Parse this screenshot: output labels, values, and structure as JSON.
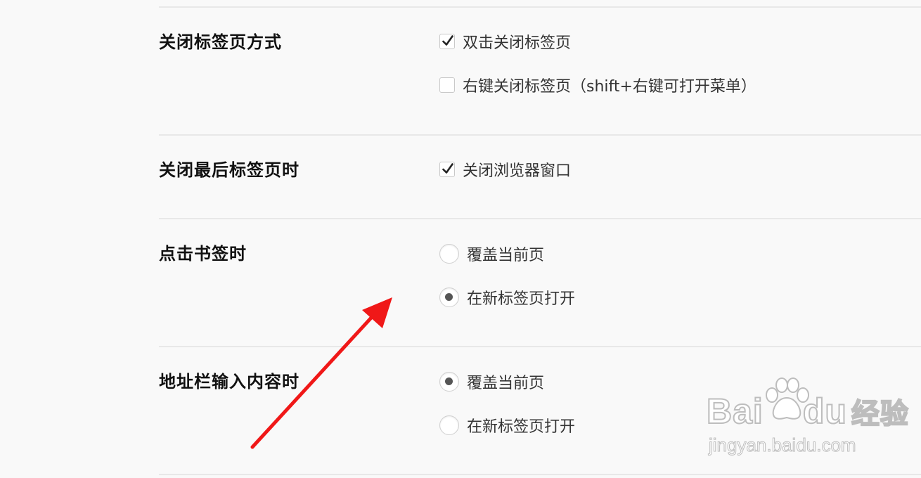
{
  "sections": [
    {
      "title": "关闭标签页方式",
      "options": [
        {
          "type": "checkbox",
          "label": "双击关闭标签页",
          "checked": true
        },
        {
          "type": "checkbox",
          "label": "右键关闭标签页（shift+右键可打开菜单）",
          "checked": false
        }
      ]
    },
    {
      "title": "关闭最后标签页时",
      "options": [
        {
          "type": "checkbox",
          "label": "关闭浏览器窗口",
          "checked": true
        }
      ]
    },
    {
      "title": "点击书签时",
      "options": [
        {
          "type": "radio",
          "label": "覆盖当前页",
          "checked": false
        },
        {
          "type": "radio",
          "label": "在新标签页打开",
          "checked": true
        }
      ]
    },
    {
      "title": "地址栏输入内容时",
      "options": [
        {
          "type": "radio",
          "label": "覆盖当前页",
          "checked": true
        },
        {
          "type": "radio",
          "label": "在新标签页打开",
          "checked": false
        }
      ]
    }
  ],
  "watermark": {
    "brand": "Bai",
    "brand_suffix": "du",
    "brand_cn": "经验",
    "url": "jingyan.baidu.com"
  },
  "colors": {
    "background": "#f9f9f9",
    "arrow": "#f01818",
    "divider": "#e8e8e8"
  }
}
